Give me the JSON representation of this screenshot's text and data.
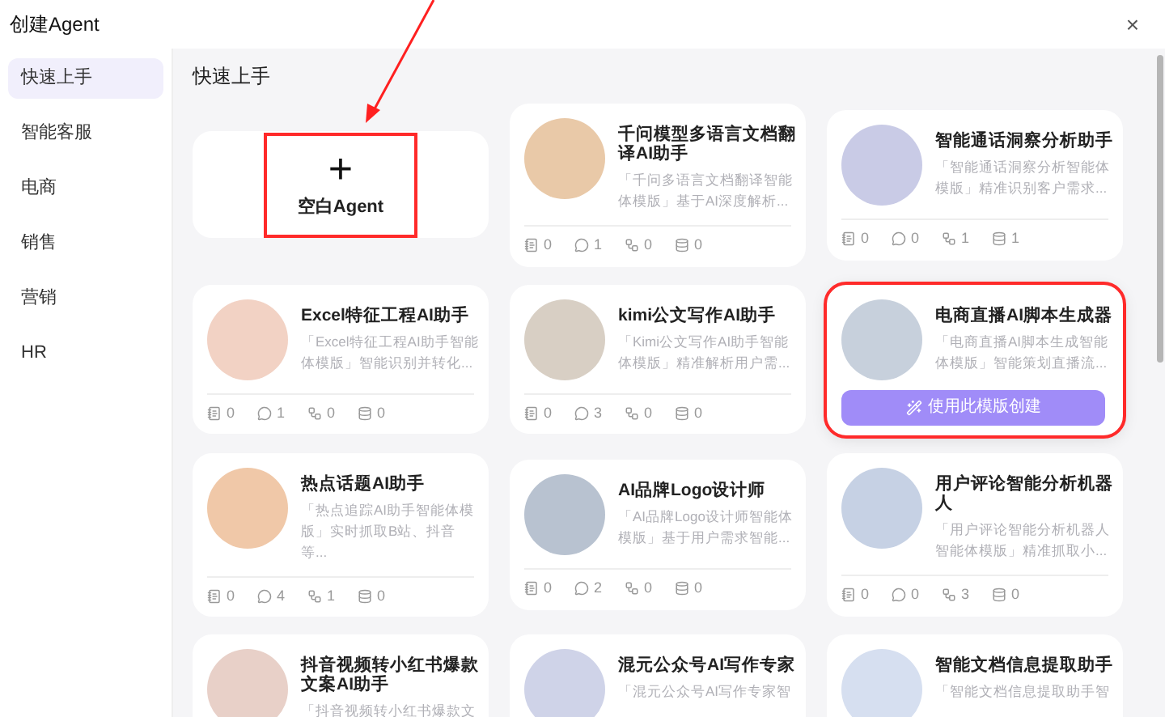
{
  "window": {
    "title": "创建Agent",
    "close": "×"
  },
  "sidebar": {
    "items": [
      {
        "label": "快速上手",
        "selected": true
      },
      {
        "label": "智能客服",
        "selected": false
      },
      {
        "label": "电商",
        "selected": false
      },
      {
        "label": "销售",
        "selected": false
      },
      {
        "label": "营销",
        "selected": false
      },
      {
        "label": "HR",
        "selected": false
      }
    ]
  },
  "section_title": "快速上手",
  "cards": [
    {
      "kind": "blank",
      "icon": "+",
      "title": "空白Agent",
      "highlighted": true
    },
    {
      "kind": "template",
      "title": "千问模型多语言文档翻译AI助手",
      "description": "「千问多语言文档翻译智能体模版」基于AI深度解析...",
      "stats": [
        "0",
        "1",
        "0",
        "0"
      ],
      "hovered": false,
      "highlighted": false
    },
    {
      "kind": "template",
      "title": "智能通话洞察分析助手",
      "description": "「智能通话洞察分析智能体模版」精准识别客户需求...",
      "stats": [
        "0",
        "0",
        "1",
        "1"
      ],
      "hovered": false,
      "highlighted": false
    },
    {
      "kind": "template",
      "title": "Excel特征工程AI助手",
      "description": "「Excel特征工程AI助手智能体模版」智能识别并转化...",
      "stats": [
        "0",
        "1",
        "0",
        "0"
      ],
      "hovered": false,
      "highlighted": false
    },
    {
      "kind": "template",
      "title": "kimi公文写作AI助手",
      "description": "「Kimi公文写作AI助手智能体模版」精准解析用户需...",
      "stats": [
        "0",
        "3",
        "0",
        "0"
      ],
      "hovered": false,
      "highlighted": false
    },
    {
      "kind": "template",
      "title": "电商直播AI脚本生成器",
      "description": "「电商直播AI脚本生成智能体模版」智能策划直播流...",
      "button": "使用此模版创建",
      "hovered": true,
      "highlighted": true
    },
    {
      "kind": "template",
      "title": "热点话题AI助手",
      "description": "「热点追踪AI助手智能体模版」实时抓取B站、抖音等...",
      "stats": [
        "0",
        "4",
        "1",
        "0"
      ],
      "hovered": false,
      "highlighted": false
    },
    {
      "kind": "template",
      "title": "AI品牌Logo设计师",
      "description": "「AI品牌Logo设计师智能体模版」基于用户需求智能...",
      "stats": [
        "0",
        "2",
        "0",
        "0"
      ],
      "hovered": false,
      "highlighted": false
    },
    {
      "kind": "template",
      "title": "用户评论智能分析机器人",
      "description": "「用户评论智能分析机器人智能体模版」精准抓取小...",
      "stats": [
        "0",
        "0",
        "3",
        "0"
      ],
      "hovered": false,
      "highlighted": false
    },
    {
      "kind": "template",
      "title": "抖音视频转小红书爆款文案AI助手",
      "description": "「抖音视频转小红书爆款文",
      "hovered": false,
      "highlighted": false
    },
    {
      "kind": "template",
      "title": "混元公众号AI写作专家",
      "description": "「混元公众号AI写作专家智",
      "hovered": false,
      "highlighted": false
    },
    {
      "kind": "template",
      "title": "智能文档信息提取助手",
      "description": "「智能文档信息提取助手智",
      "hovered": false,
      "highlighted": false
    }
  ]
}
